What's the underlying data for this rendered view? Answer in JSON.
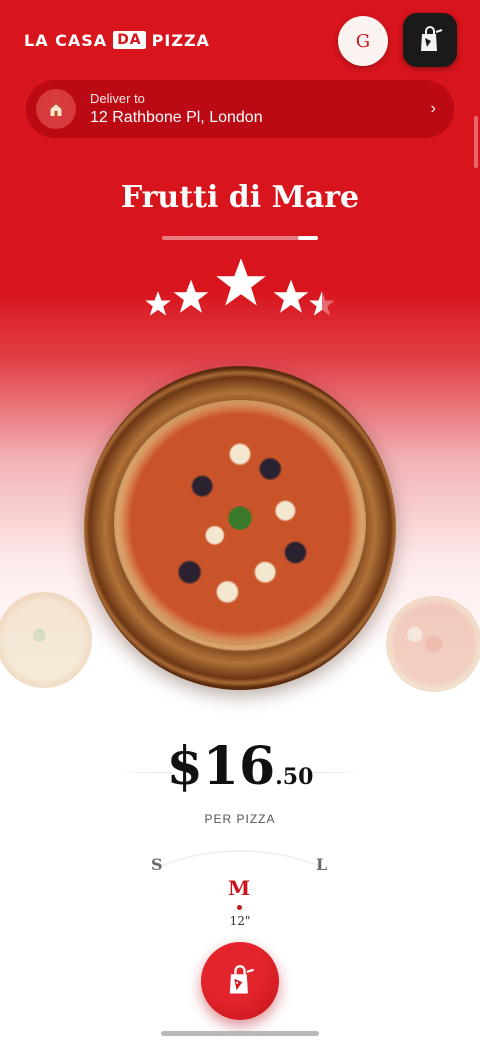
{
  "brand": {
    "part1": "LA CASA",
    "part2": "DA",
    "part3": "PIZZA"
  },
  "user": {
    "initial": "G"
  },
  "delivery": {
    "label": "Deliver to",
    "address": "12 Rathbone Pl, London",
    "chevron": "›"
  },
  "product": {
    "name": "Frutti di Mare",
    "rating": 4.5,
    "rating_max": 5,
    "price_main": "$16",
    "price_cents": ".50",
    "price_unit": "PER PIZZA"
  },
  "sizes": {
    "options": [
      "S",
      "M",
      "L"
    ],
    "selected": "M",
    "selected_inches": "12\""
  },
  "icons": {
    "cart": "shopping-bag-icon",
    "home": "home-icon",
    "add_to_cart": "add-to-bag-icon",
    "chevron": "chevron-right-icon"
  },
  "colors": {
    "brand_red": "#d8141d",
    "dark_red": "#bb0a13",
    "cart_bg": "#1a1a1a",
    "accent_text": "#c8141c"
  }
}
